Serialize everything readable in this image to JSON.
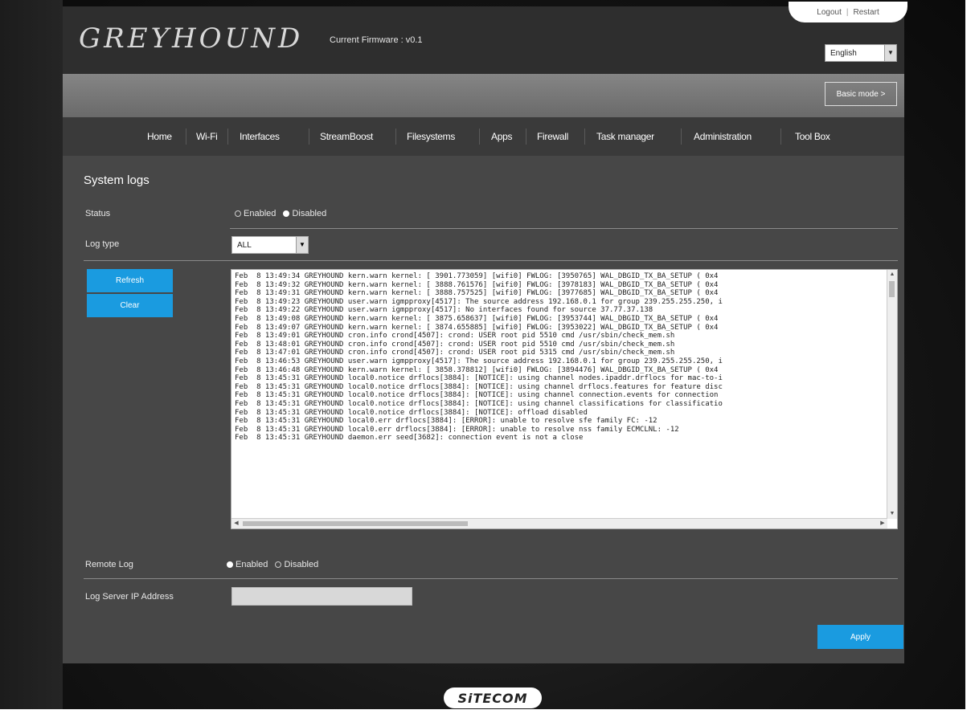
{
  "header": {
    "logo": "GREYHOUND",
    "firmware": "Current Firmware : v0.1",
    "logout": "Logout",
    "restart": "Restart",
    "language": "English"
  },
  "band": {
    "mode_button": "Basic mode >"
  },
  "nav": [
    "Home",
    "Wi-Fi",
    "Interfaces",
    "StreamBoost",
    "Filesystems",
    "Apps",
    "Firewall",
    "Task manager",
    "Administration",
    "Tool Box"
  ],
  "page": {
    "title": "System logs",
    "status_label": "Status",
    "status_enabled": "Enabled",
    "status_disabled": "Disabled",
    "logtype_label": "Log type",
    "logtype_value": "ALL",
    "refresh": "Refresh",
    "clear": "Clear",
    "log_lines": [
      "Feb  8 13:49:34 GREYHOUND kern.warn kernel: [ 3901.773059] [wifi0] FWLOG: [3950765] WAL_DBGID_TX_BA_SETUP ( 0x4",
      "Feb  8 13:49:32 GREYHOUND kern.warn kernel: [ 3888.761576] [wifi0] FWLOG: [3978183] WAL_DBGID_TX_BA_SETUP ( 0x4",
      "Feb  8 13:49:31 GREYHOUND kern.warn kernel: [ 3888.757525] [wifi0] FWLOG: [3977685] WAL_DBGID_TX_BA_SETUP ( 0x4",
      "Feb  8 13:49:23 GREYHOUND user.warn igmpproxy[4517]: The source address 192.168.0.1 for group 239.255.255.250, i",
      "Feb  8 13:49:22 GREYHOUND user.warn igmpproxy[4517]: No interfaces found for source 37.77.37.138",
      "Feb  8 13:49:08 GREYHOUND kern.warn kernel: [ 3875.658637] [wifi0] FWLOG: [3953744] WAL_DBGID_TX_BA_SETUP ( 0x4",
      "Feb  8 13:49:07 GREYHOUND kern.warn kernel: [ 3874.655885] [wifi0] FWLOG: [3953022] WAL_DBGID_TX_BA_SETUP ( 0x4",
      "Feb  8 13:49:01 GREYHOUND cron.info crond[4507]: crond: USER root pid 5510 cmd /usr/sbin/check_mem.sh",
      "Feb  8 13:48:01 GREYHOUND cron.info crond[4507]: crond: USER root pid 5510 cmd /usr/sbin/check_mem.sh",
      "Feb  8 13:47:01 GREYHOUND cron.info crond[4507]: crond: USER root pid 5315 cmd /usr/sbin/check_mem.sh",
      "Feb  8 13:46:53 GREYHOUND user.warn igmpproxy[4517]: The source address 192.168.0.1 for group 239.255.255.250, i",
      "Feb  8 13:46:48 GREYHOUND kern.warn kernel: [ 3858.378812] [wifi0] FWLOG: [3894476] WAL_DBGID_TX_BA_SETUP ( 0x4",
      "Feb  8 13:45:31 GREYHOUND local0.notice drflocs[3884]: [NOTICE]: using channel nodes.ipaddr.drflocs for mac-to-i",
      "Feb  8 13:45:31 GREYHOUND local0.notice drflocs[3884]: [NOTICE]: using channel drflocs.features for feature disc",
      "Feb  8 13:45:31 GREYHOUND local0.notice drflocs[3884]: [NOTICE]: using channel connection.events for connection",
      "Feb  8 13:45:31 GREYHOUND local0.notice drflocs[3884]: [NOTICE]: using channel classifications for classificatio",
      "Feb  8 13:45:31 GREYHOUND local0.notice drflocs[3884]: [NOTICE]: offload disabled",
      "Feb  8 13:45:31 GREYHOUND local0.err drflocs[3884]: [ERROR]: unable to resolve sfe family FC: -12",
      "Feb  8 13:45:31 GREYHOUND local0.err drflocs[3884]: [ERROR]: unable to resolve nss family ECMCLNL: -12",
      "Feb  8 13:45:31 GREYHOUND daemon.err seed[3682]: connection event is not a close"
    ],
    "remote_label": "Remote Log",
    "remote_enabled": "Enabled",
    "remote_disabled": "Disabled",
    "server_label": "Log Server IP Address",
    "server_value": "",
    "apply": "Apply"
  },
  "footer": {
    "brand": "SiTECOM"
  }
}
